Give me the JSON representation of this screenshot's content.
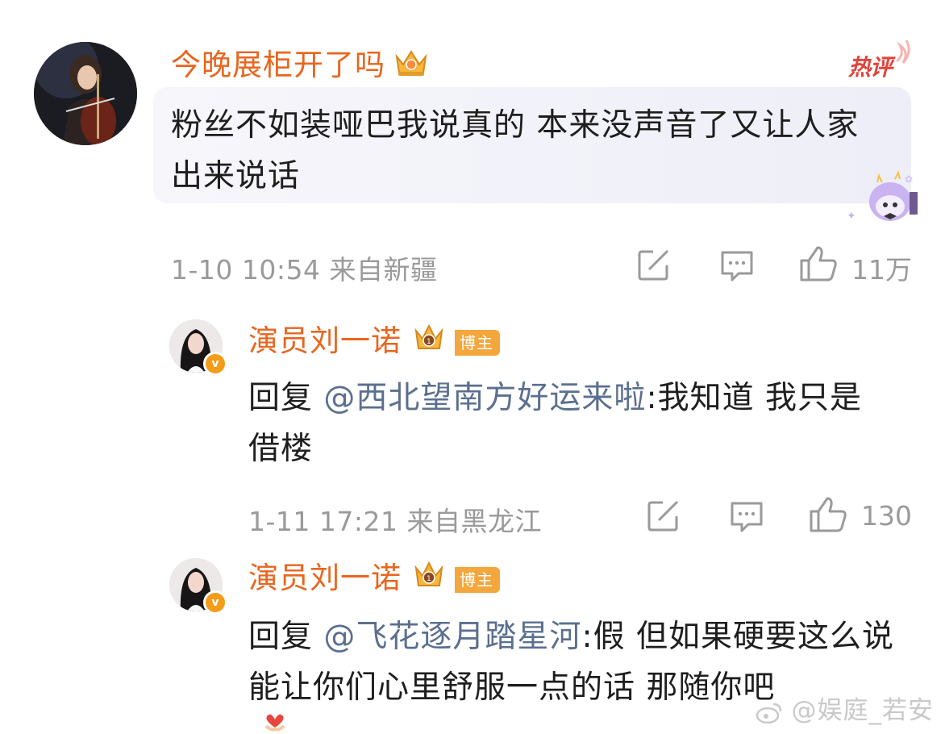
{
  "main_comment": {
    "username": "今晚展柜开了吗",
    "hot_badge": "热评",
    "text": "粉丝不如装哑巴我说真的 本来没声音了又让人家出来说话",
    "meta": "1-10 10:54 来自新疆",
    "likes": "11万"
  },
  "replies": [
    {
      "username": "演员刘一诺",
      "badge": "博主",
      "reply_prefix": "回复",
      "mention": "@西北望南方好运来啦",
      "text": ":我知道 我只是借楼",
      "meta": "1-11 17:21 来自黑龙江",
      "likes": "130"
    },
    {
      "username": "演员刘一诺",
      "badge": "博主",
      "reply_prefix": "回复",
      "mention": "@飞花逐月踏星河",
      "text": ":假 但如果硬要这么说能让你们心里舒服一点的话 那随你吧"
    }
  ],
  "watermark": "@娱庭_若安",
  "colors": {
    "username": "#e8661f",
    "mention": "#5b6f8f",
    "meta": "#9a9a9a",
    "hot": "#e2443b"
  }
}
